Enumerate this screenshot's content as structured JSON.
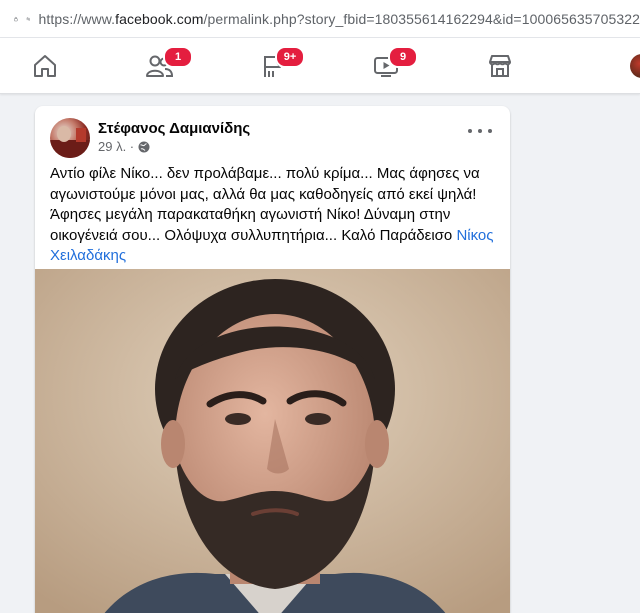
{
  "browser": {
    "url_prefix": "https://www.",
    "url_host": "facebook.com",
    "url_rest": "/permalink.php?story_fbid=180355614162294&id=100065635705322"
  },
  "nav": {
    "friends_badge": "1",
    "pages_badge": "9+",
    "watch_badge": "9"
  },
  "post": {
    "author": "Στέφανος Δαμιανίδης",
    "time": "29 λ. ·",
    "text": "Αντίο φίλε Νίκο... δεν προλάβαμε... πολύ κρίμα... Μας άφησες να αγωνιστούμε μόνοι μας, αλλά θα μας καθοδηγείς από εκεί ψηλά! Άφησες μεγάλη παρακαταθήκη αγωνιστή Νίκο! Δύναμη στην οικογένειά σου... Ολόψυχα συλλυπητήρια... Καλό Παράδεισο ",
    "tagged": "Νίκος Χειλαδάκης"
  },
  "colors": {
    "badge": "#e41e3f",
    "link": "#216fdb",
    "nav_icon": "#65676b"
  }
}
